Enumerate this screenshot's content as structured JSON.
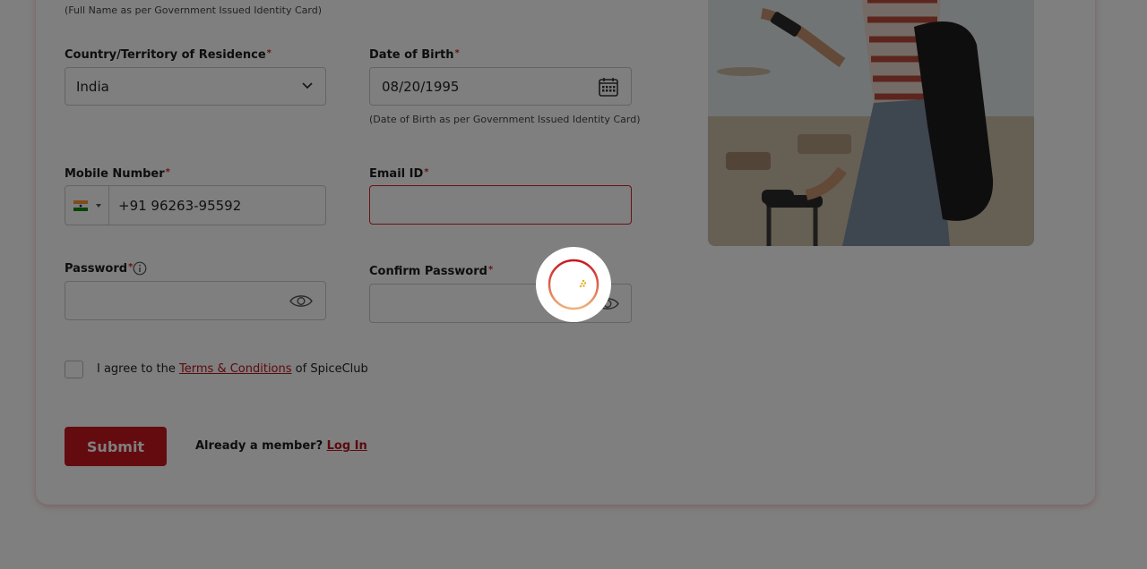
{
  "form": {
    "name_hint": "(Full Name as per Government Issued Identity Card)",
    "country": {
      "label": "Country/Territory of Residence",
      "required_mark": "*",
      "value": "India"
    },
    "dob": {
      "label": "Date of Birth",
      "required_mark": "*",
      "value": "08/20/1995",
      "hint": "(Date of Birth as per Government Issued Identity Card)"
    },
    "mobile": {
      "label": "Mobile Number",
      "required_mark": "*",
      "country_flag": "india-flag-icon",
      "value": "+91 96263-95592"
    },
    "email": {
      "label": "Email ID",
      "required_mark": "*",
      "value": ""
    },
    "password": {
      "label": "Password",
      "required_mark": "*",
      "value": ""
    },
    "confirm_password": {
      "label": "Confirm Password",
      "required_mark": "*",
      "value": ""
    },
    "terms": {
      "prefix": "I agree to the",
      "link": "Terms & Conditions",
      "suffix": "of SpiceClub",
      "checked": false
    },
    "submit_label": "Submit",
    "member": {
      "text": "Already a member?",
      "link": "Log In"
    }
  },
  "colors": {
    "brand": "#c8161e",
    "error": "#d3222a",
    "overlay": "rgba(0,0,0,0.5)"
  },
  "icons": [
    "chevron-down-icon",
    "calendar-icon",
    "info-icon",
    "eye-icon",
    "loading-spinner-icon"
  ]
}
